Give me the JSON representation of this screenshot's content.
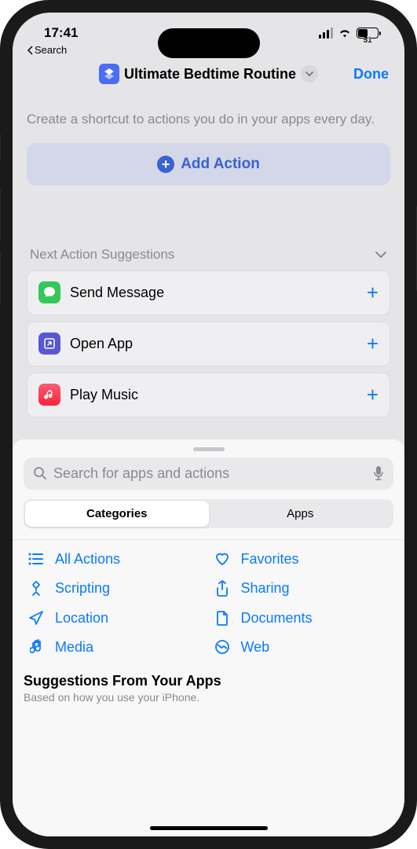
{
  "status": {
    "time": "17:41",
    "battery": "51"
  },
  "back": "Search",
  "header": {
    "title": "Ultimate Bedtime Routine",
    "done": "Done"
  },
  "intro": "Create a shortcut to actions you do in your apps every day.",
  "add_action": "Add Action",
  "suggestions": {
    "title": "Next Action Suggestions",
    "items": [
      {
        "label": "Send Message",
        "icon": "messages",
        "color": "#34c759"
      },
      {
        "label": "Open App",
        "icon": "open-app",
        "color": "#5856d6"
      },
      {
        "label": "Play Music",
        "icon": "music",
        "color": "#ff3b30"
      }
    ]
  },
  "search": {
    "placeholder": "Search for apps and actions"
  },
  "tabs": {
    "categories": "Categories",
    "apps": "Apps"
  },
  "categories": [
    {
      "label": "All Actions",
      "icon": "list"
    },
    {
      "label": "Favorites",
      "icon": "heart"
    },
    {
      "label": "Scripting",
      "icon": "scripting"
    },
    {
      "label": "Sharing",
      "icon": "share"
    },
    {
      "label": "Location",
      "icon": "location"
    },
    {
      "label": "Documents",
      "icon": "document"
    },
    {
      "label": "Media",
      "icon": "media"
    },
    {
      "label": "Web",
      "icon": "web"
    }
  ],
  "apps_suggest": {
    "title": "Suggestions From Your Apps",
    "sub": "Based on how you use your iPhone."
  }
}
